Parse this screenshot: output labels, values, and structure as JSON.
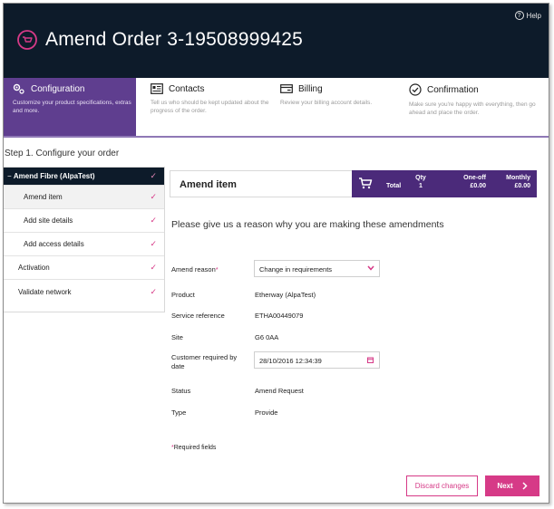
{
  "header": {
    "help_label": "Help",
    "title": "Amend Order 3-19508999425"
  },
  "steps": [
    {
      "title": "Configuration",
      "description": "Customize your product specifications, extras and more."
    },
    {
      "title": "Contacts",
      "description": "Tell us who should be kept updated about the progress of the order."
    },
    {
      "title": "Billing",
      "description": "Review your billing account details."
    },
    {
      "title": "Confirmation",
      "description": "Make sure you're happy with everything, then go ahead and place the order."
    }
  ],
  "step_heading": "Step 1. Configure your order",
  "sidebar": {
    "items": [
      {
        "label": "Amend Fibre (AlpaTest)",
        "prefix": "−",
        "check": "✓"
      },
      {
        "label": "Amend item",
        "check": "✓"
      },
      {
        "label": "Add site details",
        "check": "✓"
      },
      {
        "label": "Add access details",
        "check": "✓"
      },
      {
        "label": "Activation",
        "check": "✓"
      },
      {
        "label": "Validate network",
        "check": "✓"
      }
    ]
  },
  "panel": {
    "title": "Amend item",
    "cart": {
      "total_label": "Total",
      "qty_label": "Qty",
      "qty_value": "1",
      "oneoff_label": "One-off",
      "oneoff_value": "£0.00",
      "monthly_label": "Monthly",
      "monthly_value": "£0.00"
    },
    "reason_prompt": "Please give us a reason why you are making these amendments"
  },
  "form": {
    "amend_reason_label": "Amend reason",
    "required_marker": "*",
    "amend_reason_value": "Change in requirements",
    "product_label": "Product",
    "product_value": "Etherway (AlpaTest)",
    "service_reference_label": "Service reference",
    "service_reference_value": "ETHA00449079",
    "site_label": "Site",
    "site_value": "G6 0AA",
    "customer_required_label": "Customer required by date",
    "customer_required_value": "28/10/2016 12:34:39",
    "status_label": "Status",
    "status_value": "Amend Request",
    "type_label": "Type",
    "type_value": "Provide",
    "required_note": "*Required fields"
  },
  "actions": {
    "discard_label": "Discard changes",
    "next_label": "Next"
  },
  "colors": {
    "header_bg": "#0d1b2a",
    "accent_pink": "#d63a87",
    "active_step_purple": "#5f3e8f",
    "cart_purple": "#4b2a7a"
  }
}
